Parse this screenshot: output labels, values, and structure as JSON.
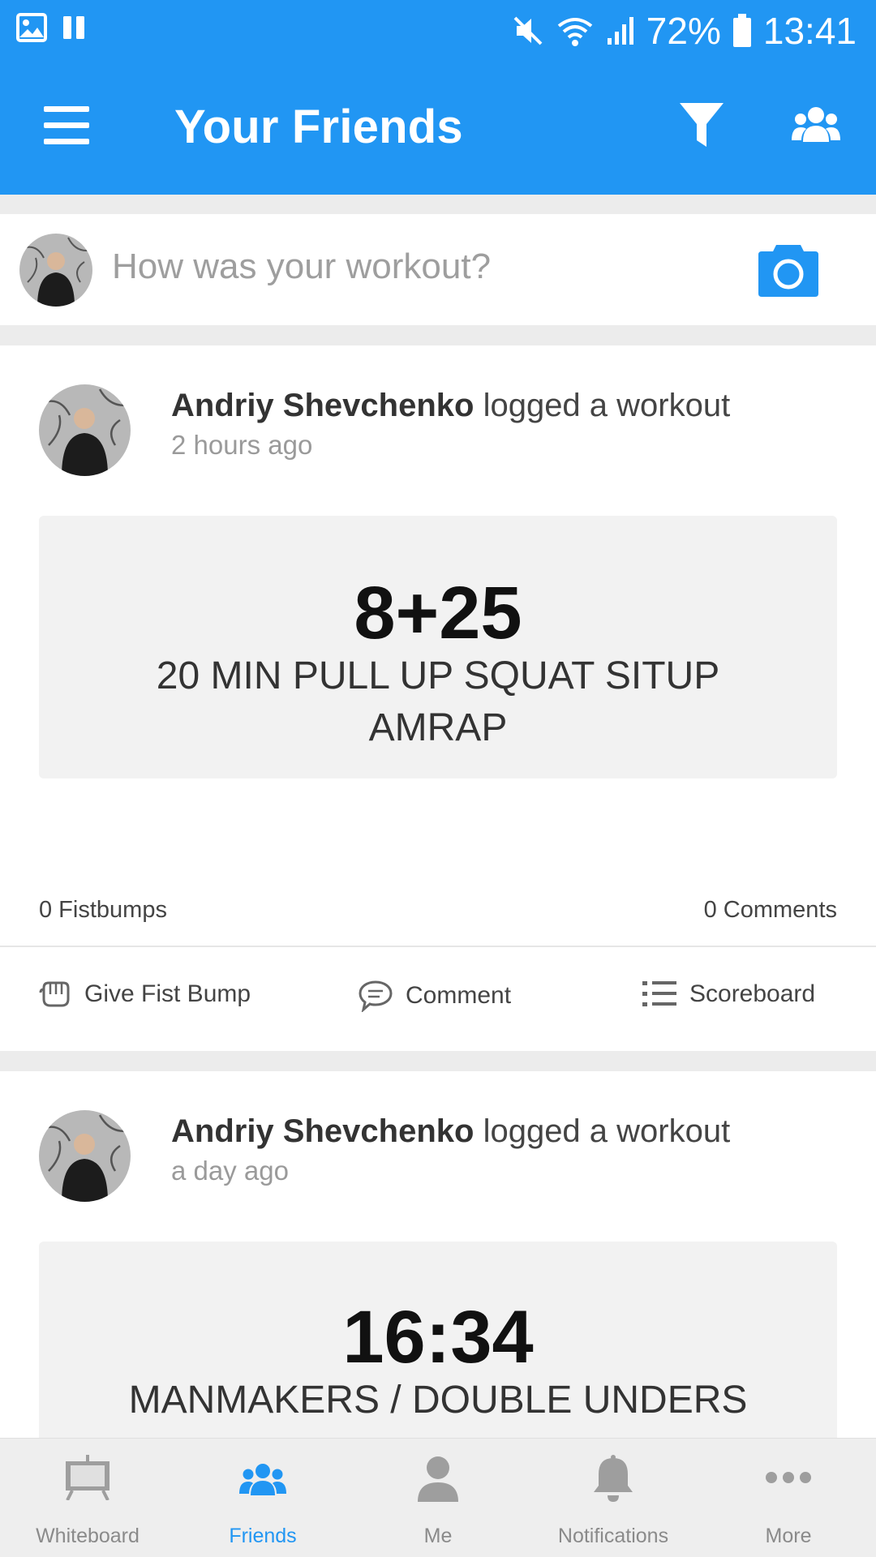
{
  "status_bar": {
    "battery": "72%",
    "time": "13:41"
  },
  "app_bar": {
    "title": "Your Friends",
    "icons": [
      "menu-icon",
      "filter-icon",
      "group-icon"
    ]
  },
  "composer": {
    "placeholder": "How was your workout?",
    "icon": "camera-icon"
  },
  "feed": [
    {
      "author": "Andriy Shevchenko",
      "action": "logged a workout",
      "time": "2 hours ago",
      "score": "8+25",
      "workout_line1": "20 MIN PULL UP SQUAT SITUP",
      "workout_line2": "AMRAP",
      "fistbumps": "0 Fistbumps",
      "comments": "0 Comments",
      "actions": {
        "fist_bump": "Give Fist Bump",
        "comment": "Comment",
        "scoreboard": "Scoreboard"
      }
    },
    {
      "author": "Andriy Shevchenko",
      "action": "logged a workout",
      "time": "a day ago",
      "score": "16:34",
      "workout_line1": "MANMAKERS / DOUBLE UNDERS"
    }
  ],
  "bottom_nav": [
    {
      "label": "Whiteboard",
      "icon": "whiteboard-icon",
      "active": false
    },
    {
      "label": "Friends",
      "icon": "friends-icon",
      "active": true
    },
    {
      "label": "Me",
      "icon": "person-icon",
      "active": false
    },
    {
      "label": "Notifications",
      "icon": "bell-icon",
      "active": false
    },
    {
      "label": "More",
      "icon": "more-icon",
      "active": false
    }
  ],
  "colors": {
    "primary": "#2196f3",
    "background": "#ececec",
    "card": "#ffffff",
    "result_box": "#f2f2f2"
  }
}
